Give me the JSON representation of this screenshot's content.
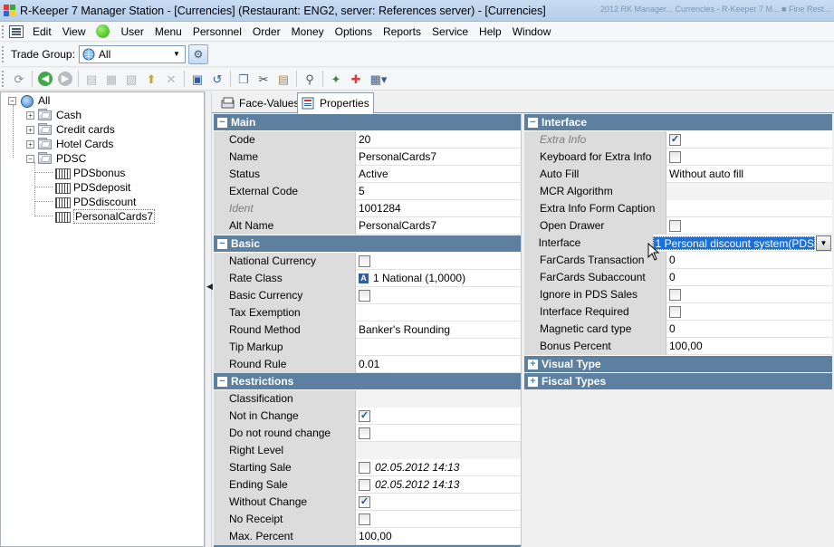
{
  "window": {
    "title": "R-Keeper 7 Manager Station - [Currencies] (Restaurant: ENG2, server: References server) - [Currencies]",
    "ghost_tabs": "2012 RK Manager... Currencies - R-Keeper 7 M...     ■ Fine Rest..."
  },
  "menu": [
    "Edit",
    "View",
    "User",
    "Menu",
    "Personnel",
    "Order",
    "Money",
    "Options",
    "Reports",
    "Service",
    "Help",
    "Window"
  ],
  "trade_group": {
    "label": "Trade Group:",
    "value": "All"
  },
  "tree": {
    "root": "All",
    "items": [
      {
        "label": "Cash"
      },
      {
        "label": "Credit cards"
      },
      {
        "label": "Hotel Cards"
      },
      {
        "label": "PDSC"
      }
    ],
    "children": [
      {
        "label": "PDSbonus"
      },
      {
        "label": "PDSdeposit"
      },
      {
        "label": "PDSdiscount"
      },
      {
        "label": "PersonalCards7"
      }
    ]
  },
  "tabs": [
    {
      "label": "Face-Values"
    },
    {
      "label": "Properties"
    }
  ],
  "left": {
    "main": {
      "title": "Main",
      "rows": [
        {
          "name": "Code",
          "value": "20"
        },
        {
          "name": "Name",
          "value": "PersonalCards7"
        },
        {
          "name": "Status",
          "value": "Active"
        },
        {
          "name": "External Code",
          "value": "5"
        },
        {
          "name": "Ident",
          "value": "1001284"
        },
        {
          "name": "Alt Name",
          "value": "PersonalCards7"
        }
      ]
    },
    "basic": {
      "title": "Basic",
      "rows": [
        {
          "name": "National Currency",
          "value": ""
        },
        {
          "name": "Rate Class",
          "value": "1 National (1,0000)"
        },
        {
          "name": "Basic Currency",
          "value": ""
        },
        {
          "name": "Tax Exemption",
          "value": ""
        },
        {
          "name": "Round Method",
          "value": "Banker's Rounding"
        },
        {
          "name": "Tip Markup",
          "value": ""
        },
        {
          "name": "Round Rule",
          "value": "0.01"
        }
      ]
    },
    "restrictions": {
      "title": "Restrictions",
      "rows": [
        {
          "name": "Classification",
          "value": ""
        },
        {
          "name": "Not in Change",
          "value": ""
        },
        {
          "name": "Do not round change",
          "value": ""
        },
        {
          "name": "Right Level",
          "value": ""
        },
        {
          "name": "Starting Sale",
          "value": "02.05.2012 14:13"
        },
        {
          "name": "Ending Sale",
          "value": "02.05.2012 14:13"
        },
        {
          "name": "Without Change",
          "value": ""
        },
        {
          "name": "No Receipt",
          "value": ""
        },
        {
          "name": "Max. Percent",
          "value": "100,00"
        }
      ]
    },
    "rate_badge": "A"
  },
  "right": {
    "interface": {
      "title": "Interface",
      "rows": [
        {
          "name": "Extra Info",
          "value": ""
        },
        {
          "name": "Keyboard for Extra Info",
          "value": ""
        },
        {
          "name": "Auto Fill",
          "value": "Without auto fill"
        },
        {
          "name": "MCR Algorithm",
          "value": ""
        },
        {
          "name": "Extra Info Form Caption",
          "value": ""
        },
        {
          "name": "Open Drawer",
          "value": ""
        },
        {
          "name": "Interface",
          "value": "1 Personal discount system(PDS"
        },
        {
          "name": "FarCards Transaction",
          "value": "0"
        },
        {
          "name": "FarCards Subaccount",
          "value": "0"
        },
        {
          "name": "Ignore in PDS Sales",
          "value": ""
        },
        {
          "name": "Interface Required",
          "value": ""
        },
        {
          "name": "Magnetic card type",
          "value": "0"
        },
        {
          "name": "Bonus Percent",
          "value": "100,00"
        }
      ]
    },
    "visual_type": {
      "title": "Visual Type"
    },
    "fiscal_types": {
      "title": "Fiscal Types"
    }
  },
  "checkboxes": {
    "national_currency": false,
    "basic_currency": false,
    "not_in_change": true,
    "do_not_round_change": false,
    "starting_sale": false,
    "ending_sale": false,
    "without_change": true,
    "no_receipt": false,
    "extra_info": true,
    "keyboard_for_extra_info": false,
    "open_drawer": false,
    "ignore_in_pds_sales": false,
    "interface_required": false
  },
  "colors": {
    "section_header": "#5d7fa0",
    "selection": "#1f6fd6",
    "title_bar": "#c9dcf2"
  }
}
